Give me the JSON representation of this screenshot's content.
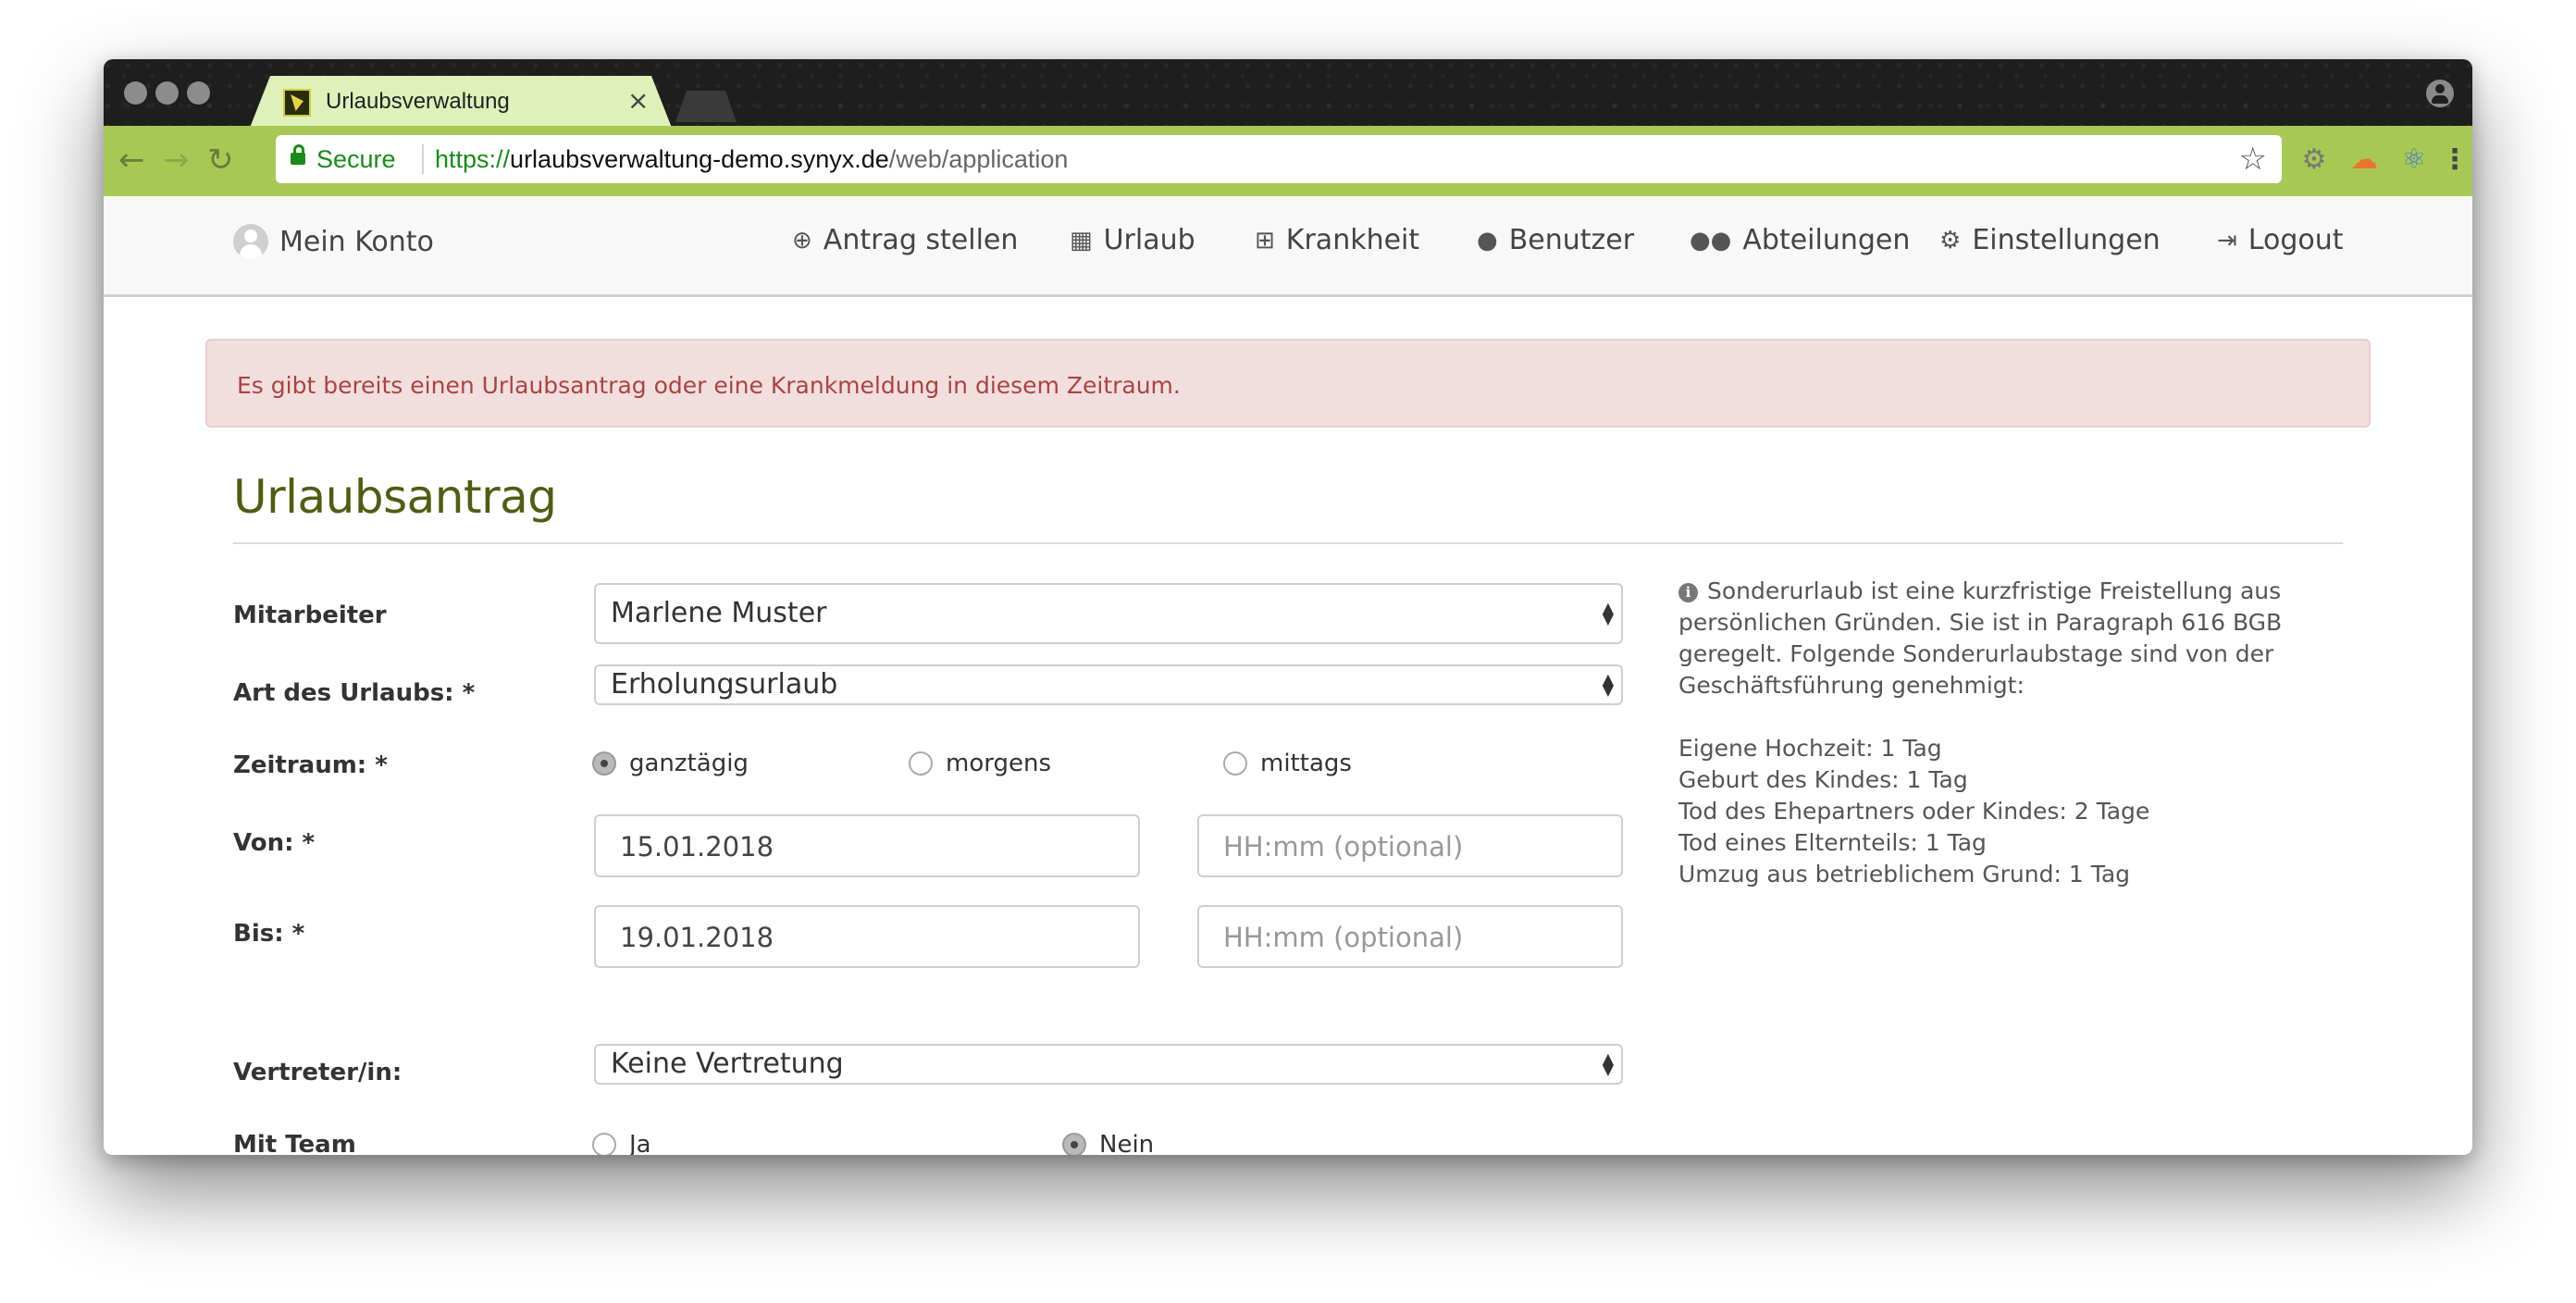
{
  "browser": {
    "tab_title": "Urlaubsverwaltung",
    "tab_close": "×",
    "secure_label": "Secure",
    "url_scheme": "https://",
    "url_host": "urlaubsverwaltung-demo.synyx.de",
    "url_path": "/web/application"
  },
  "nav": {
    "account": "Mein Konto",
    "items": [
      {
        "label": "Antrag stellen",
        "icon": "plus-circle-icon"
      },
      {
        "label": "Urlaub",
        "icon": "calendar-icon"
      },
      {
        "label": "Krankheit",
        "icon": "medkit-icon"
      },
      {
        "label": "Benutzer",
        "icon": "user-icon"
      },
      {
        "label": "Abteilungen",
        "icon": "users-icon"
      },
      {
        "label": "Einstellungen",
        "icon": "cog-icon"
      },
      {
        "label": "Logout",
        "icon": "sign-out-icon"
      }
    ]
  },
  "alert": {
    "text": "Es gibt bereits einen Urlaubsantrag oder eine Krankmeldung in diesem Zeitraum."
  },
  "form": {
    "title": "Urlaubsantrag",
    "employee_label": "Mitarbeiter",
    "employee_value": "Marlene Muster",
    "type_label": "Art des Urlaubs: *",
    "type_value": "Erholungsurlaub",
    "period_label": "Zeitraum: *",
    "period_options": [
      {
        "label": "ganztägig",
        "checked": true
      },
      {
        "label": "morgens",
        "checked": false
      },
      {
        "label": "mittags",
        "checked": false
      }
    ],
    "from_label": "Von: *",
    "from_date": "15.01.2018",
    "from_time_placeholder": "HH:mm (optional)",
    "to_label": "Bis: *",
    "to_date": "19.01.2018",
    "to_time_placeholder": "HH:mm (optional)",
    "substitute_label": "Vertreter/in:",
    "substitute_value": "Keine Vertretung",
    "team_label": "Mit Team",
    "team_options": [
      {
        "label": "Ja",
        "checked": false
      },
      {
        "label": "Nein",
        "checked": true
      }
    ]
  },
  "info": {
    "intro": [
      "Sonderurlaub ist eine kurzfristige Freistellung aus",
      "persönlichen Gründen. Sie ist in Paragraph 616 BGB",
      "geregelt. Folgende Sonderurlaubstage sind von der",
      "Geschäftsführung genehmigt:"
    ],
    "items": [
      "Eigene Hochzeit: 1 Tag",
      "Geburt des Kindes: 1 Tag",
      "Tod des Ehepartners oder Kindes: 2 Tage",
      "Tod eines Elternteils: 1 Tag",
      "Umzug aus betrieblichem Grund: 1 Tag"
    ]
  },
  "colors": {
    "toolbar": "#a7c954",
    "tab": "#dff0b9",
    "title": "#4f5d14",
    "alert_bg": "#f2dede",
    "alert_text": "#a94442"
  }
}
